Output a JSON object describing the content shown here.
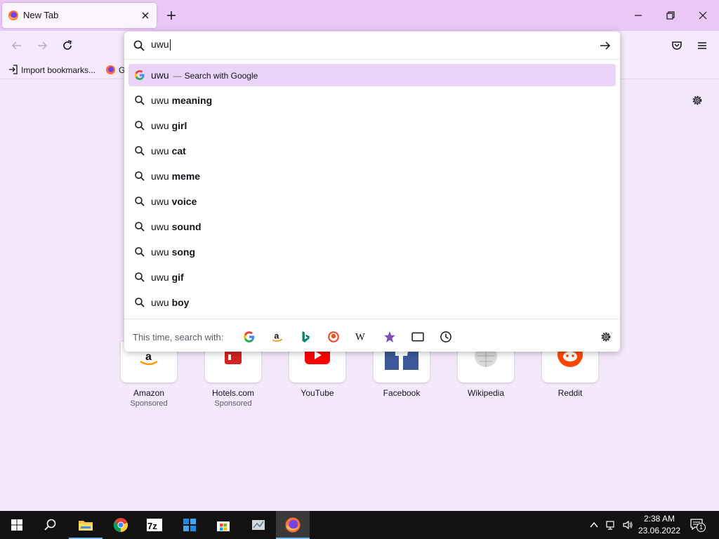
{
  "tab": {
    "title": "New Tab"
  },
  "bookmarks": {
    "import_label": "Import bookmarks...",
    "second_label": "G"
  },
  "urlbar": {
    "value": "uwu",
    "suggestions": [
      {
        "prefix": "uwu",
        "suffix": "",
        "separator": "—",
        "action": "Search with Google"
      },
      {
        "prefix": "uwu",
        "suffix": "meaning"
      },
      {
        "prefix": "uwu",
        "suffix": "girl"
      },
      {
        "prefix": "uwu",
        "suffix": "cat"
      },
      {
        "prefix": "uwu",
        "suffix": "meme"
      },
      {
        "prefix": "uwu",
        "suffix": "voice"
      },
      {
        "prefix": "uwu",
        "suffix": "sound"
      },
      {
        "prefix": "uwu",
        "suffix": "song"
      },
      {
        "prefix": "uwu",
        "suffix": "gif"
      },
      {
        "prefix": "uwu",
        "suffix": "boy"
      }
    ],
    "oneoff_label": "This time, search with:",
    "engines": [
      "google-icon",
      "amazon-icon",
      "bing-icon",
      "duckduckgo-icon",
      "wikipedia-icon",
      "bookmarks-icon",
      "tabs-icon",
      "history-icon"
    ]
  },
  "top_sites": [
    {
      "name": "Amazon",
      "sponsored": "Sponsored"
    },
    {
      "name": "Hotels.com",
      "sponsored": "Sponsored"
    },
    {
      "name": "YouTube",
      "sponsored": ""
    },
    {
      "name": "Facebook",
      "sponsored": ""
    },
    {
      "name": "Wikipedia",
      "sponsored": ""
    },
    {
      "name": "Reddit",
      "sponsored": ""
    }
  ],
  "taskbar": {
    "apps": [
      "start-icon",
      "search-icon",
      "file-explorer-icon",
      "chrome-icon",
      "7zip-icon",
      "app-icon",
      "store-icon",
      "screenshot-icon",
      "firefox-icon"
    ],
    "time": "2:38 AM",
    "date": "23.06.2022",
    "notification_count": "1"
  },
  "colors": {
    "accent": "#e9c8f5",
    "selected": "#ead4f8",
    "taskbar": "#121212"
  }
}
